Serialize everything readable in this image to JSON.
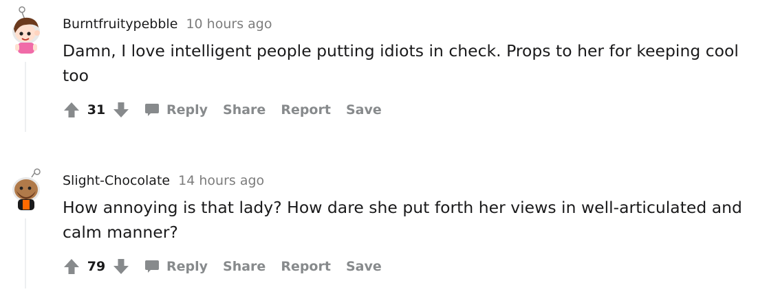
{
  "comments": [
    {
      "username": "Burntfruitypebble",
      "time": "10 hours ago",
      "text": "Damn, I love intelligent people putting idiots in check. Props to her for keeping cool too",
      "score": "31",
      "reply_label": "Reply",
      "share_label": "Share",
      "report_label": "Report",
      "save_label": "Save",
      "avatar_icon": "snoo-avatar-brown-hair-pink-shirt"
    },
    {
      "username": "Slight-Chocolate",
      "time": "14 hours ago",
      "text": "How annoying is that lady? How dare she put forth her views in well-articulated and calm manner?",
      "score": "79",
      "reply_label": "Reply",
      "share_label": "Share",
      "report_label": "Report",
      "save_label": "Save",
      "avatar_icon": "snoo-avatar-brown-beard-orange-shirt"
    }
  ],
  "icons": {
    "upvote": "upvote-arrow-icon",
    "downvote": "downvote-arrow-icon",
    "reply": "speech-bubble-icon"
  },
  "colors": {
    "text": "#1a1a1b",
    "muted": "#7c7c7c",
    "action": "#878a8c",
    "thread_line": "#edeff1"
  }
}
